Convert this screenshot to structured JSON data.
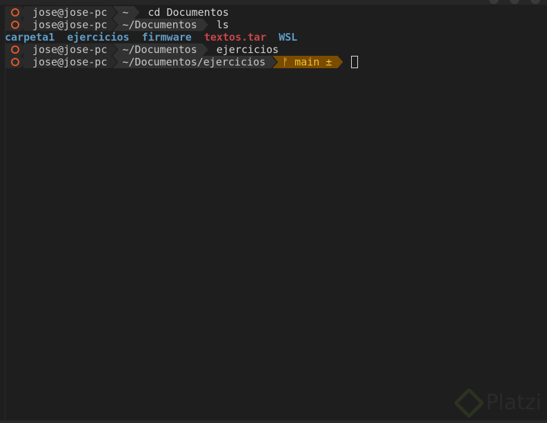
{
  "prompt": {
    "user": "jose@jose-pc",
    "icon": "ubuntu-icon"
  },
  "lines": [
    {
      "dir": "~",
      "command": "cd Documentos"
    },
    {
      "dir": "~/Documentos",
      "command": "ls"
    },
    {
      "dir": "~/Documentos",
      "command": "ejercicios"
    },
    {
      "dir": "~/Documentos/ejercicios",
      "git_branch": "main",
      "git_status": "±",
      "git_icon": "ᚠ"
    }
  ],
  "ls_output": [
    "carpeta1",
    "ejercicios",
    "firmware",
    "textos.tar",
    "WSL"
  ],
  "colors": {
    "background": "#1e1e1e",
    "directory": "#5f9ec9",
    "archive": "#c8464a",
    "git_bg": "#7a4c00",
    "git_fg": "#f2c230",
    "ubuntu": "#e05a2a"
  },
  "watermark": "Platzi"
}
